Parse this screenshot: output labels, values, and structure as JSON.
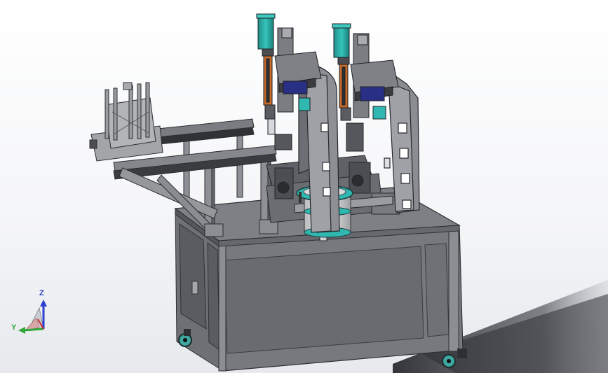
{
  "viewport": {
    "background": "#f4f5f7",
    "shadow_color": "#2f3035"
  },
  "model": {
    "frame_color": "#8b8d92",
    "panel_color": "#75777c",
    "dark_panel_color": "#5d5f64",
    "accent_teal": "#2fb7b0",
    "accent_blue": "#2a2f86",
    "accent_orange": "#c46a2a",
    "caster_color": "#3fa6a0"
  },
  "triad": {
    "z_label": "Z",
    "y_label": "Y",
    "z_color": "#2b3fd0",
    "y_color": "#2fa838",
    "x_color": "#d03030"
  }
}
